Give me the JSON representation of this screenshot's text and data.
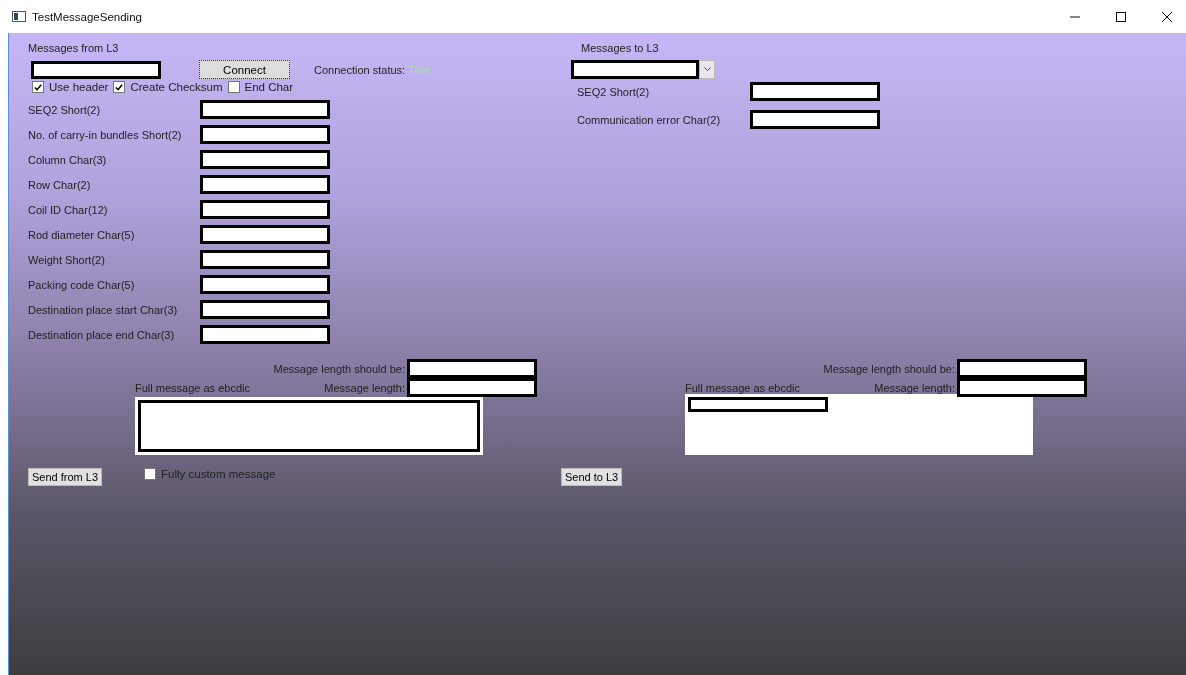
{
  "window": {
    "title": "TestMessageSending"
  },
  "from_l3": {
    "heading": "Messages from L3",
    "connect_button": "Connect",
    "options": [
      {
        "label": "Use header",
        "checked": true
      },
      {
        "label": "Create Checksum",
        "checked": true
      },
      {
        "label": "End Char",
        "checked": false
      }
    ],
    "connection_status": {
      "label": "Connection status:",
      "value": "True"
    },
    "fields": [
      {
        "label": "SEQ2 Short(2)"
      },
      {
        "label": "No. of carry-in bundles Short(2)"
      },
      {
        "label": "Column Char(3)"
      },
      {
        "label": "Row Char(2)"
      },
      {
        "label": "Coil ID Char(12)"
      },
      {
        "label": "Rod diameter Char(5)"
      },
      {
        "label": "Weight Short(2)"
      },
      {
        "label": "Packing code Char(5)"
      },
      {
        "label": "Destination place start Char(3)"
      },
      {
        "label": "Destination place end Char(3)"
      }
    ],
    "message": {
      "length_expected_label": "Message length should be:",
      "full_message_label": "Full message as ebcdic",
      "length_label": "Message length:"
    },
    "send_button": "Send from L3",
    "custom_message": {
      "label": "Fully custom message",
      "checked": false
    }
  },
  "to_l3": {
    "heading": "Messages to L3",
    "fields": [
      {
        "label": "SEQ2 Short(2)"
      },
      {
        "label": "Communication error Char(2)"
      }
    ],
    "message": {
      "length_expected_label": "Message length should be:",
      "full_message_label": "Full message as ebcdic",
      "length_label": "Message length:"
    },
    "send_button": "Send to L3"
  }
}
